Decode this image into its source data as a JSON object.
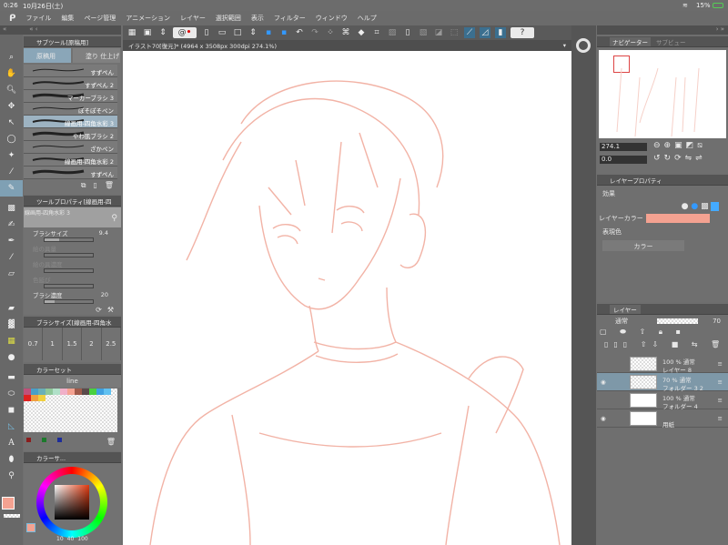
{
  "status": {
    "time": "0:26",
    "date": "10月26日(土)",
    "battery": "15%"
  },
  "menu": [
    "ファイル",
    "編集",
    "ページ管理",
    "アニメーション",
    "レイヤー",
    "選択範囲",
    "表示",
    "フィルター",
    "ウィンドウ",
    "ヘルプ"
  ],
  "canvas_tab": "イラスト70[復元]* (4964 x 3508px 300dpi 274.1%)",
  "subtool": {
    "title": "サブツール[原稿用]",
    "tabs": [
      "原稿用",
      "塗り 仕上げ"
    ],
    "brushes": [
      "すずぺん",
      "すずぺん 2",
      "マーカーブラシ 3",
      "ぽそぽそペン",
      "線画用-四角水彩 3",
      "やわ肌ブラシ 2",
      "ざかペン",
      "線画用-四角水彩 2",
      "すずぺん"
    ],
    "selected_index": 4
  },
  "tool_property": {
    "title": "ツールプロパティ[線画用-四",
    "preview_name": "線画用-四角水彩 3",
    "props": [
      {
        "label": "ブラシサイズ",
        "value": "9.4",
        "fill": 0.3
      },
      {
        "label": "絵の具量",
        "value": "",
        "fill": 0
      },
      {
        "label": "絵の具濃度",
        "value": "",
        "fill": 0
      },
      {
        "label": "色延び",
        "value": "",
        "fill": 0
      },
      {
        "label": "ブラシ濃度",
        "value": "20",
        "fill": 0.2
      }
    ]
  },
  "brush_size": {
    "title": "ブラシサイズ[線画用-四角水",
    "sizes": [
      "0.7",
      "1",
      "1.5",
      "2",
      "2.5"
    ]
  },
  "color_set": {
    "title": "カラーセット",
    "set_name": "line"
  },
  "color_circle": {
    "title": "カラーサ...",
    "values": [
      "10",
      "40",
      "100"
    ]
  },
  "colors": {
    "main": "#f4a291",
    "accent": "#3b6f8f",
    "sketch": "#f2b3a6"
  },
  "navigator": {
    "tabs": [
      "ナビゲーター",
      "サブビュー"
    ],
    "zoom": "274.1",
    "rotation": "0.0"
  },
  "layer_property": {
    "title": "レイヤープロパティ",
    "effect_label": "効果",
    "layer_color_label": "レイヤーカラー",
    "expression_label": "表現色",
    "expression_value": "カラー"
  },
  "layers": {
    "tab": "レイヤー",
    "blend": "通常",
    "opacity": "70",
    "items": [
      {
        "mode": "100 % 通常",
        "name": "レイヤー 8"
      },
      {
        "mode": "70 % 通常",
        "name": "フォルダー 3 2"
      },
      {
        "mode": "100 % 通常",
        "name": "フォルダー 4"
      },
      {
        "mode": "",
        "name": "用紙"
      }
    ]
  }
}
